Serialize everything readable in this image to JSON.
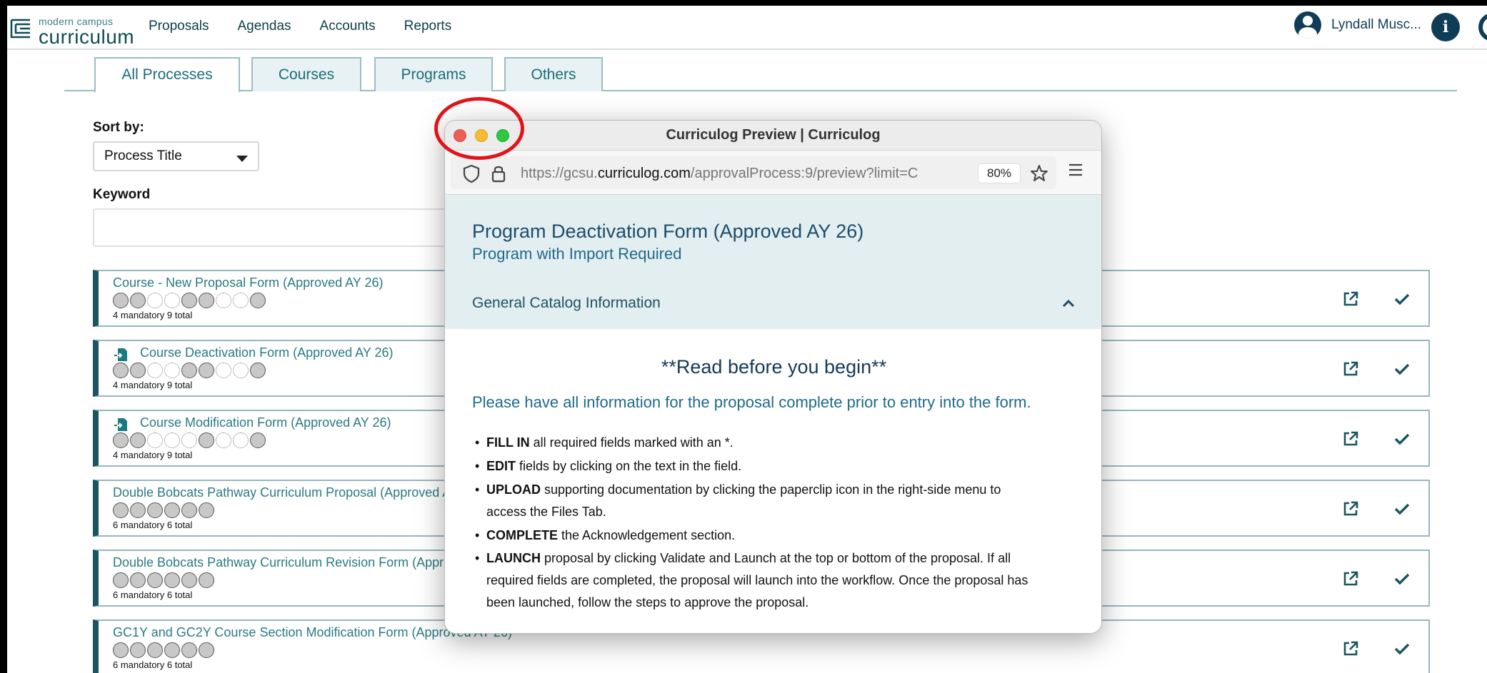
{
  "app": {
    "logo_line1": "modern campus",
    "logo_line2": "curriculum",
    "logo_tm": "™"
  },
  "nav": {
    "items": [
      "Proposals",
      "Agendas",
      "Accounts",
      "Reports"
    ]
  },
  "user": {
    "name": "Lyndall Musc..."
  },
  "tabs": [
    "All Processes",
    "Courses",
    "Programs",
    "Others"
  ],
  "sort": {
    "label": "Sort by:",
    "value": "Process Title"
  },
  "keyword": {
    "label": "Keyword",
    "value": ""
  },
  "processes": [
    {
      "title": "Course - New Proposal Form (Approved AY 26)",
      "count": "4 mandatory 9 total",
      "has_icon": false
    },
    {
      "title": "Course Deactivation Form (Approved AY 26)",
      "count": "4 mandatory 9 total",
      "has_icon": true
    },
    {
      "title": "Course Modification Form (Approved AY 26)",
      "count": "4 mandatory 9 total",
      "has_icon": true
    },
    {
      "title": "Double Bobcats Pathway Curriculum Proposal (Approved AY",
      "count": "6 mandatory 6 total",
      "has_icon": false
    },
    {
      "title": "Double Bobcats Pathway Curriculum Revision Form (Approv",
      "count": "6 mandatory 6 total",
      "has_icon": false
    },
    {
      "title": "GC1Y and GC2Y Course Section Modification Form (Approved AY 26)",
      "count": "6 mandatory 6 total",
      "has_icon": false
    }
  ],
  "preview": {
    "window_title": "Curriculog Preview | Curriculog",
    "url_prefix": "https://gcsu.",
    "url_domain": "curriculog.com",
    "url_suffix": "/approvalProcess:9/preview?limit=C",
    "zoom": "80%",
    "form_title": "Program Deactivation Form (Approved AY 26)",
    "form_subtitle": "Program with Import Required",
    "section": "General Catalog Information",
    "read_heading": "**Read before you begin**",
    "please": "Please have all information for the proposal complete prior to entry into the form.",
    "bullets": [
      {
        "bold": "FILL IN",
        "text": " all required fields marked with an *."
      },
      {
        "bold": "EDIT",
        "text": " fields by clicking on the text in the field."
      },
      {
        "bold": "UPLOAD",
        "text": " supporting documentation by clicking the paperclip icon in the right-side menu to access the Files Tab."
      },
      {
        "bold": "COMPLETE",
        "text": " the Acknowledgement section."
      },
      {
        "bold": "LAUNCH",
        "text": " proposal by clicking Validate and Launch at the top or bottom of the proposal.  If all required fields are completed, the proposal will launch into the workflow. Once the proposal has been launched, follow the steps to approve the proposal."
      }
    ]
  },
  "colors": {
    "accent": "#1a5560",
    "link": "#2a7a84",
    "highlight_ring": "#e0141a"
  }
}
